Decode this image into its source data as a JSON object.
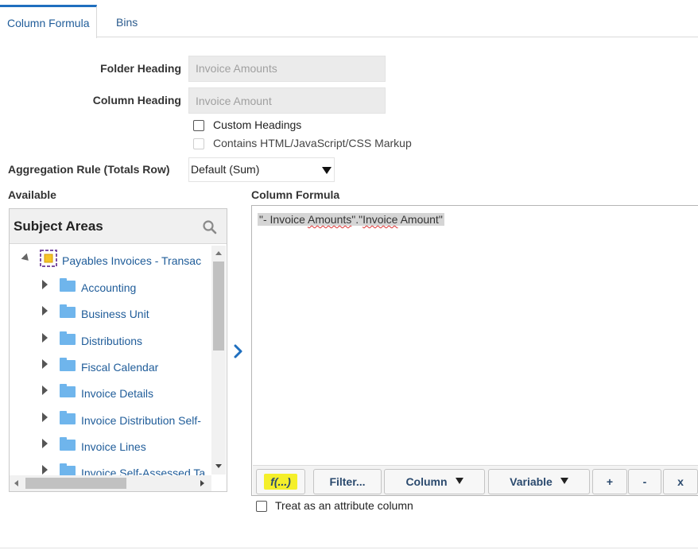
{
  "tabs": [
    {
      "label": "Column Formula",
      "active": true
    },
    {
      "label": "Bins",
      "active": false
    }
  ],
  "form": {
    "folder_heading_label": "Folder Heading",
    "folder_heading_value": "Invoice Amounts",
    "column_heading_label": "Column Heading",
    "column_heading_value": "Invoice Amount",
    "custom_headings_label": "Custom Headings",
    "custom_headings_checked": false,
    "contains_markup_label": "Contains HTML/JavaScript/CSS Markup",
    "contains_markup_checked": false,
    "aggregation_label": "Aggregation Rule (Totals Row)",
    "aggregation_value": "Default (Sum)"
  },
  "available": {
    "label": "Available",
    "panel_title": "Subject Areas",
    "root": "Payables Invoices - Transac",
    "folders": [
      "Accounting",
      "Business Unit",
      "Distributions",
      "Fiscal Calendar",
      "Invoice Details",
      "Invoice Distribution Self-",
      "Invoice Lines",
      "Invoice Self-Assessed Ta"
    ]
  },
  "formula": {
    "label": "Column Formula",
    "text_prefix": "\"- Invoice ",
    "text_word1": "Amounts",
    "text_mid": "\".\"",
    "text_word2": "Invoice",
    "text_suffix": " Amount\"",
    "toolbar": {
      "fx": "f(...)",
      "filter": "Filter...",
      "column": "Column",
      "variable": "Variable",
      "plus": "+",
      "minus": "-",
      "times": "x"
    }
  },
  "attribute_checkbox_label": "Treat as an attribute column",
  "attribute_checkbox_checked": false,
  "colors": {
    "accent": "#1f6fbf",
    "link": "#1f5c99",
    "highlight": "#f4ef2a",
    "folder": "#6fb5ec"
  }
}
